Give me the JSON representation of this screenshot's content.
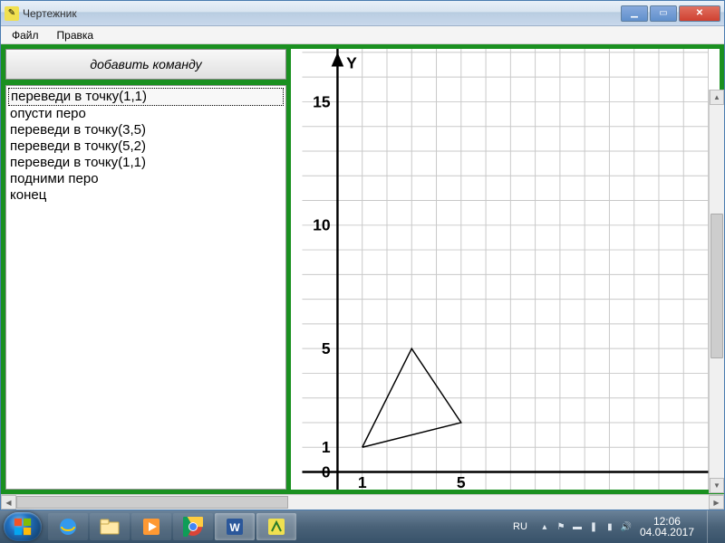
{
  "window": {
    "title": "Чертежник"
  },
  "menu": {
    "file": "Файл",
    "edit": "Правка"
  },
  "controls": {
    "add_command": "добавить команду"
  },
  "commands": [
    "переведи в точку(1,1)",
    "опусти перо",
    "переведи в точку(3,5)",
    "переведи в точку(5,2)",
    "переведи в точку(1,1)",
    "подними перо",
    "конец"
  ],
  "chart_data": {
    "type": "line",
    "title": "",
    "xlabel": "",
    "ylabel": "Y",
    "xlim": [
      0,
      15
    ],
    "ylim": [
      0,
      17
    ],
    "y_ticks": [
      0,
      1,
      5,
      10,
      15
    ],
    "x_ticks": [
      1,
      5
    ],
    "series": [
      {
        "name": "triangle",
        "x": [
          1,
          3,
          5,
          1
        ],
        "y": [
          1,
          5,
          2,
          1
        ]
      }
    ]
  },
  "taskbar": {
    "lang": "RU",
    "time": "12:06",
    "date": "04.04.2017"
  }
}
